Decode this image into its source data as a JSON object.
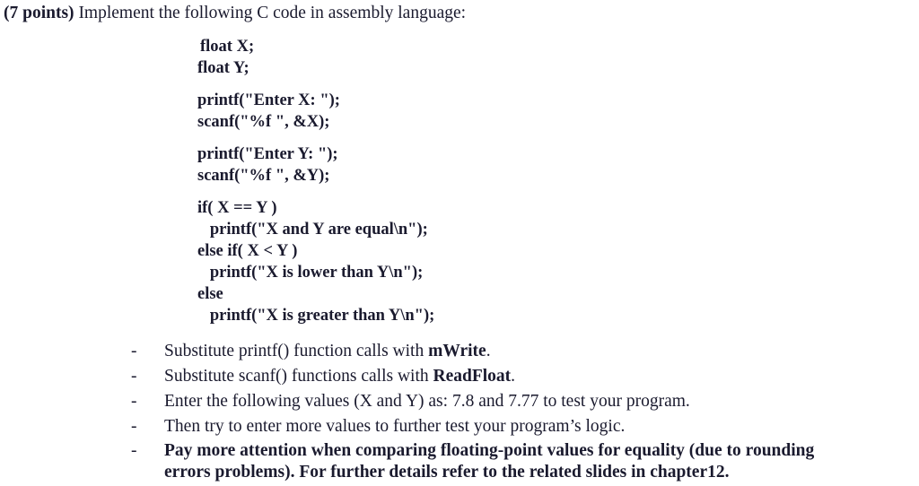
{
  "document": {
    "question": {
      "points_label": "(7 points)",
      "prompt": " Implement the following C code in assembly language:"
    },
    "code_block": {
      "lines": [
        "float X;",
        "float Y;",
        "",
        "printf(\"Enter X: \");",
        "scanf(\"%f \", &X);",
        "",
        "printf(\"Enter Y: \");",
        "scanf(\"%f \", &Y);",
        "",
        "if( X == Y )",
        "   printf(\"X and Y are equal\\n\");",
        "else if( X < Y )",
        "   printf(\"X is lower than Y\\n\");",
        "else",
        "   printf(\"X is greater than Y\\n\");"
      ]
    },
    "instructions": {
      "marker": "-",
      "items": [
        {
          "bold": false,
          "parts": [
            {
              "text": "Substitute printf() function calls with ",
              "bold": false
            },
            {
              "text": "mWrite",
              "bold": true
            },
            {
              "text": ".",
              "bold": false
            }
          ]
        },
        {
          "bold": false,
          "parts": [
            {
              "text": "Substitute scanf() functions calls with ",
              "bold": false
            },
            {
              "text": "ReadFloat",
              "bold": true
            },
            {
              "text": ".",
              "bold": false
            }
          ]
        },
        {
          "bold": false,
          "parts": [
            {
              "text": "Enter the following values (X and Y) as: 7.8 and 7.77 to test your program.",
              "bold": false
            }
          ]
        },
        {
          "bold": false,
          "parts": [
            {
              "text": "Then try to enter more values to further test your program’s logic.",
              "bold": false
            }
          ]
        },
        {
          "bold": true,
          "parts": [
            {
              "text": "Pay more attention when comparing floating-point values for equality (due to rounding errors problems). For further details refer to the related slides in chapter12.",
              "bold": true
            }
          ]
        }
      ]
    },
    "colors": {
      "text": "#1a1a2e",
      "background": "#ffffff"
    }
  }
}
